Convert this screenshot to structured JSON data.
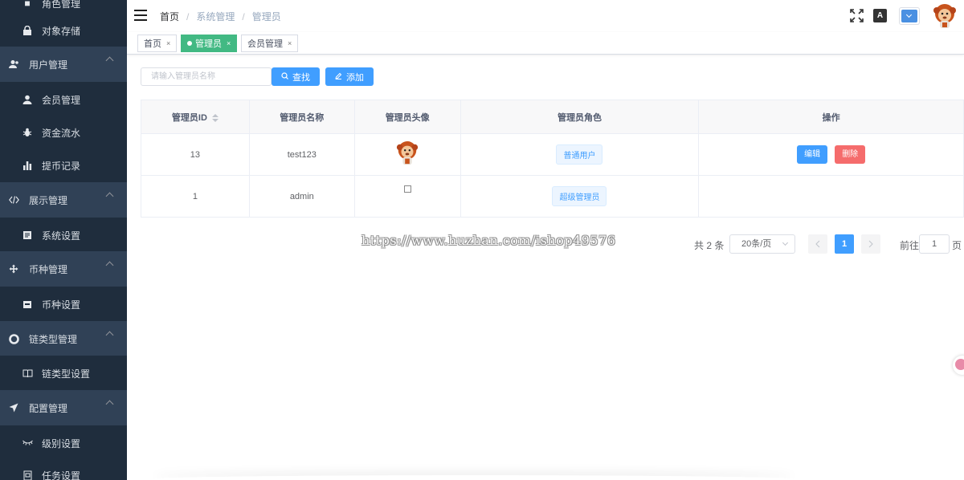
{
  "sidebar": {
    "items": [
      {
        "label": "角色管理",
        "type": "sub",
        "icon": "role-icon"
      },
      {
        "label": "对象存储",
        "type": "sub",
        "icon": "lock-icon"
      },
      {
        "label": "用户管理",
        "type": "group",
        "icon": "users-icon"
      },
      {
        "label": "会员管理",
        "type": "sub",
        "icon": "user-icon"
      },
      {
        "label": "资金流水",
        "type": "sub",
        "icon": "bug-icon"
      },
      {
        "label": "提币记录",
        "type": "sub",
        "icon": "bar-chart-icon"
      },
      {
        "label": "展示管理",
        "type": "group",
        "icon": "code-icon"
      },
      {
        "label": "系统设置",
        "type": "sub",
        "icon": "document-icon"
      },
      {
        "label": "币种管理",
        "type": "group",
        "icon": "move-icon"
      },
      {
        "label": "币种设置",
        "type": "sub",
        "icon": "wallet-icon"
      },
      {
        "label": "链类型管理",
        "type": "group",
        "icon": "lifebuoy-icon"
      },
      {
        "label": "链类型设置",
        "type": "sub",
        "icon": "book-icon"
      },
      {
        "label": "配置管理",
        "type": "group",
        "icon": "send-icon"
      },
      {
        "label": "级别设置",
        "type": "sub",
        "icon": "eye-closed-icon"
      },
      {
        "label": "任务设置",
        "type": "sub",
        "icon": "clipboard-icon"
      }
    ]
  },
  "header": {
    "breadcrumb": [
      "首页",
      "系统管理",
      "管理员"
    ],
    "translate_glyph": "A"
  },
  "tags": [
    {
      "label": "首页",
      "active": false
    },
    {
      "label": "管理员",
      "active": true
    },
    {
      "label": "会员管理",
      "active": false
    }
  ],
  "filter": {
    "placeholder": "请输入管理员名称",
    "search_label": "查找",
    "add_label": "添加"
  },
  "table": {
    "columns": [
      "管理员ID",
      "管理员名称",
      "管理员头像",
      "管理员角色",
      "操作"
    ],
    "rows": [
      {
        "id": "13",
        "name": "test123",
        "role": "普通用户"
      },
      {
        "id": "1",
        "name": "admin",
        "role": "超级管理员"
      }
    ],
    "edit_label": "编辑",
    "delete_label": "删除"
  },
  "pagination": {
    "total": "共 2 条",
    "page_size": "20条/页",
    "current": "1",
    "goto_label": "前往",
    "goto_value": "1",
    "page_label": "页"
  },
  "watermark": "https://www.huzhan.com/ishop49576",
  "colors": {
    "sidebar_bg": "#1f2d3d",
    "group_bg": "#304156",
    "primary": "#409eff",
    "danger": "#f56c6c",
    "active_tag": "#42b983"
  }
}
